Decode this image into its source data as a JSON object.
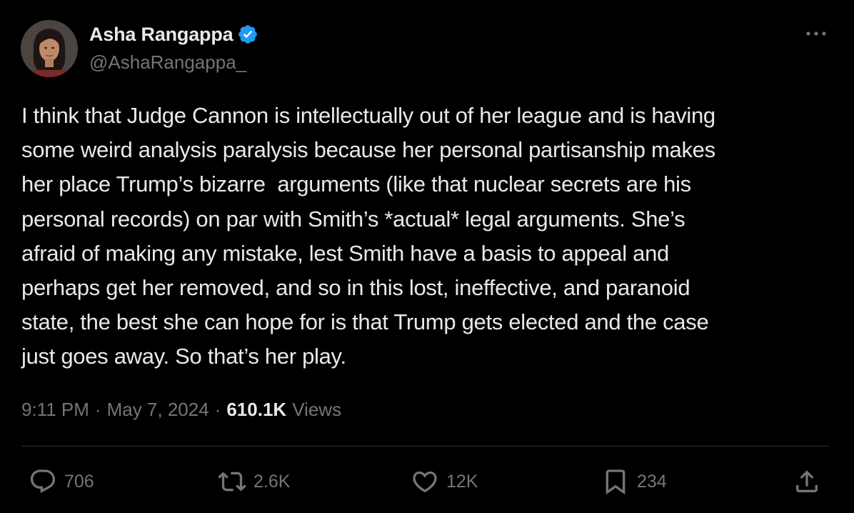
{
  "author": {
    "name": "Asha Rangappa",
    "handle": "@AshaRangappa_",
    "verified": true
  },
  "tweet": {
    "text": "I think that Judge Cannon is intellectually out of her league and is having\nsome weird analysis paralysis because her personal partisanship makes\nher place Trump’s bizarre  arguments (like that nuclear secrets are his\npersonal records) on par with Smith’s *actual* legal arguments. She’s\nafraid of making any mistake, lest Smith have a basis to appeal and\nperhaps get her removed, and so in this lost, ineffective, and paranoid\nstate, the best she can hope for is that Trump gets elected and the case\njust goes away. So that’s her play."
  },
  "meta": {
    "time": "9:11 PM",
    "separator": "·",
    "date": "May 7, 2024",
    "views_count": "610.1K",
    "views_label": "Views"
  },
  "actions": {
    "replies": "706",
    "reposts": "2.6K",
    "likes": "12K",
    "bookmarks": "234"
  },
  "icons": {
    "more": "more-horizontal-icon",
    "verified": "verified-badge-icon",
    "reply": "reply-icon",
    "repost": "repost-icon",
    "like": "heart-icon",
    "bookmark": "bookmark-icon",
    "share": "share-icon"
  },
  "colors": {
    "background": "#000000",
    "primary_text": "#e7e9ea",
    "secondary_text": "#71767b",
    "verified_blue": "#1d9bf0",
    "divider": "#2f3336"
  }
}
